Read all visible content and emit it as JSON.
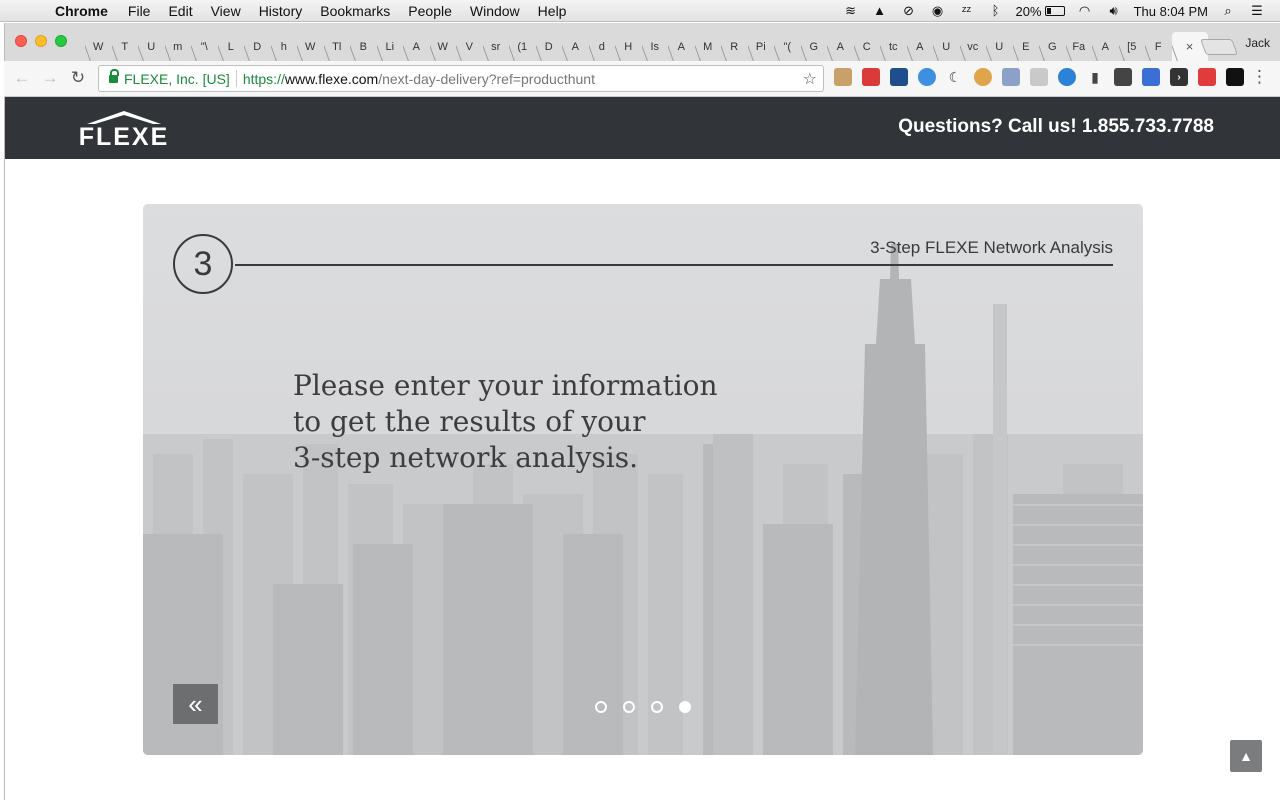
{
  "menubar": {
    "app": "Chrome",
    "items": [
      "File",
      "Edit",
      "View",
      "History",
      "Bookmarks",
      "People",
      "Window",
      "Help"
    ],
    "battery": "20%",
    "clock": "Thu 8:04 PM"
  },
  "browser": {
    "tabs": [
      "W",
      "T",
      "U",
      "m",
      "\"\\",
      "L",
      "D",
      "h",
      "W",
      "Tl",
      "B",
      "Li",
      "A",
      "W",
      "V",
      "sr",
      "(1",
      "D",
      "A",
      "d",
      "H",
      "Is",
      "A",
      "M",
      "R",
      "Pi",
      "\"(",
      "G",
      "A",
      "C",
      "tc",
      "A",
      "U",
      "vc",
      "U",
      "E",
      "G",
      "Fa",
      "A",
      "[5",
      "F"
    ],
    "active_tab_close": "×",
    "profile": "Jack",
    "security_label": "FLEXE, Inc. [US]",
    "url_scheme": "https://",
    "url_host": "www.flexe.com",
    "url_path": "/next-day-delivery?ref=producthunt"
  },
  "site": {
    "logo_text": "FLEXE",
    "phone_text": "Questions? Call us! 1.855.733.7788"
  },
  "hero": {
    "step_number": "3",
    "step_title": "3-Step FLEXE Network Analysis",
    "headline_lines": [
      "Please enter your information",
      "to get the results of your",
      "3-step network analysis."
    ],
    "back_label": "«",
    "dots_total": 4,
    "active_dot": 4
  },
  "colors": {
    "header_bg": "#313438",
    "secure_green": "#1a8c3b"
  }
}
